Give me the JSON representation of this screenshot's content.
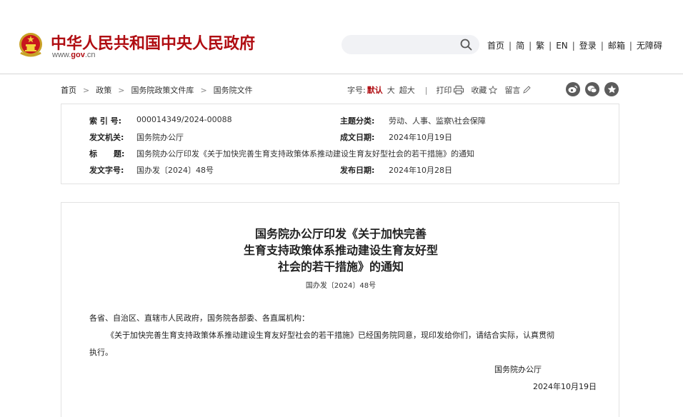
{
  "header": {
    "site_title": "中华人民共和国中央人民政府",
    "url_prefix": "www.",
    "url_brand": "gov",
    "url_suffix": ".cn",
    "nav": [
      "首页",
      "简",
      "繁",
      "EN",
      "登录",
      "邮箱",
      "无障碍"
    ]
  },
  "breadcrumb": [
    "首页",
    "政策",
    "国务院政策文件库",
    "国务院文件"
  ],
  "tools": {
    "font_label": "字号:",
    "font_default": "默认",
    "font_large": "大",
    "font_xlarge": "超大",
    "print": "打印",
    "favorite": "收藏",
    "comment": "留言"
  },
  "info": {
    "index_label": "索 引 号:",
    "index_value": "000014349/2024-00088",
    "topic_label": "主题分类:",
    "topic_value": "劳动、人事、监察\\社会保障",
    "issuer_label": "发文机关:",
    "issuer_value": "国务院办公厅",
    "written_label": "成文日期:",
    "written_value": "2024年10月19日",
    "title_label": "标      题:",
    "title_value": "国务院办公厅印发《关于加快完善生育支持政策体系推动建设生育友好型社会的若干措施》的通知",
    "docno_label": "发文字号:",
    "docno_value": "国办发〔2024〕48号",
    "publish_label": "发布日期:",
    "publish_value": "2024年10月28日"
  },
  "document": {
    "title_line1": "国务院办公厅印发《关于加快完善",
    "title_line2": "生育支持政策体系推动建设生育友好型",
    "title_line3": "社会的若干措施》的通知",
    "doc_number": "国办发〔2024〕48号",
    "greeting": "各省、自治区、直辖市人民政府，国务院各部委、各直属机构：",
    "body_line1": "《关于加快完善生育支持政策体系推动建设生育友好型社会的若干措施》已经国务院同意，现印发给你们，请结合实际，认真贯彻",
    "body_line2": "执行。",
    "signature": "国务院办公厅",
    "date": "2024年10月19日"
  },
  "colors": {
    "brand_red": "#b00d12",
    "share_icon_bg": "#5c5c5c"
  }
}
